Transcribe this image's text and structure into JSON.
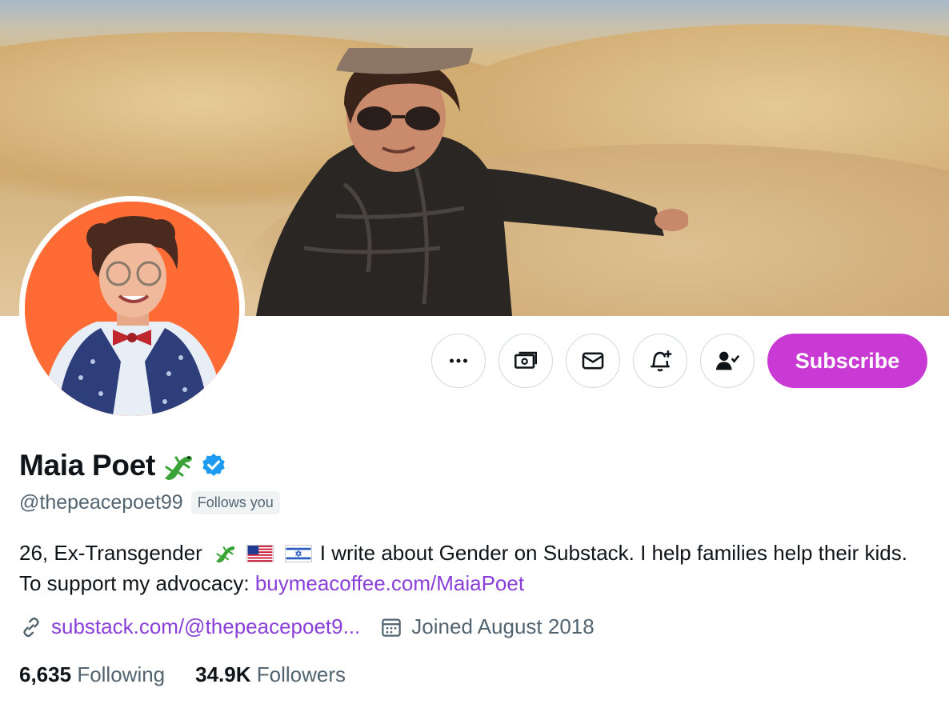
{
  "profile": {
    "name": "Maia Poet",
    "name_emoji": "lizard",
    "verified": true,
    "handle": "@thepeacepoet99",
    "follows_you_badge": "Follows you",
    "bio_text": "26, Ex-Transgender",
    "bio_text_2": "I write about Gender on Substack. I help families help their kids. To support my advocacy: ",
    "bio_link": "buymeacoffee.com/MaiaPoet",
    "website": "substack.com/@thepeacepoet9...",
    "joined": "Joined August 2018",
    "following_count": "6,635",
    "following_label": "Following",
    "followers_count": "34.9K",
    "followers_label": "Followers"
  },
  "actions": {
    "more_icon": "more-icon",
    "tip_icon": "money-icon",
    "message_icon": "mail-icon",
    "notify_icon": "bell-plus-icon",
    "following_icon": "user-check-icon",
    "subscribe_label": "Subscribe"
  },
  "colors": {
    "subscribe_bg": "#c93ad4",
    "link": "#8b3fd9",
    "verified": "#1d9bf0",
    "avatar_bg": "#ff6b35"
  }
}
